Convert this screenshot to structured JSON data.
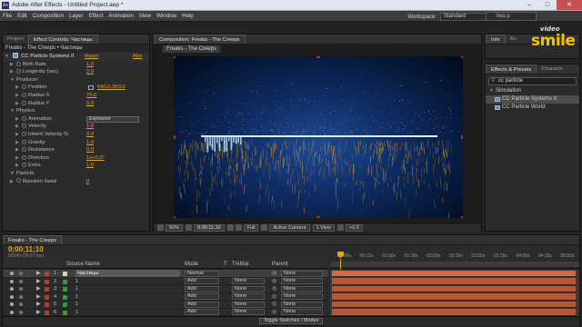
{
  "window": {
    "app_icon": "Ae",
    "title": "Adobe After Effects - Untitled Project.aep *"
  },
  "menu": [
    "File",
    "Edit",
    "Composition",
    "Layer",
    "Effect",
    "Animation",
    "View",
    "Window",
    "Help"
  ],
  "workspace": {
    "label": "Workspace:",
    "value": "Standard"
  },
  "help_search": {
    "placeholder": "Sea       p"
  },
  "left_panel": {
    "tabs": [
      "Project",
      "Effect Controls: Частицы"
    ],
    "header": "Freaks - The Creeps • Частицы",
    "effect": {
      "name": "CC Particle Systems II",
      "reset": "Reset",
      "about": "Abo"
    },
    "rows": [
      {
        "label": "Birth Rate",
        "value": "1.0",
        "indent": 1
      },
      {
        "label": "Longevity (sec)",
        "value": "2.0",
        "indent": 1
      },
      {
        "label": "Producer",
        "value": "",
        "indent": 1,
        "group": true
      },
      {
        "label": "Position",
        "value": "640.0,360.0",
        "indent": 2
      },
      {
        "label": "Radius X",
        "value": "75.0",
        "indent": 2
      },
      {
        "label": "Radius Y",
        "value": "0.0",
        "indent": 2
      },
      {
        "label": "Physics",
        "value": "",
        "indent": 1,
        "group": true
      },
      {
        "label": "Animation",
        "value": "Explosive",
        "indent": 2,
        "dropdown": true
      },
      {
        "label": "Velocity",
        "value": "1.0",
        "indent": 2
      },
      {
        "label": "Inherit Velocity %",
        "value": "0.0",
        "indent": 2
      },
      {
        "label": "Gravity",
        "value": "1.0",
        "indent": 2
      },
      {
        "label": "Resistance",
        "value": "0.0",
        "indent": 2
      },
      {
        "label": "Direction",
        "value": "1x+0.0°",
        "indent": 2
      },
      {
        "label": "Extra",
        "value": "1.0",
        "indent": 2
      },
      {
        "label": "Particle",
        "value": "",
        "indent": 1,
        "group": true
      },
      {
        "label": "Random Seed",
        "value": "0",
        "indent": 1
      }
    ]
  },
  "composition": {
    "tab": "Composition: Freaks - The Creeps",
    "sub_tab": "Freaks - The Creeps",
    "zoom": "50%",
    "timecode": "0;00;11;10",
    "resolution": "Full",
    "camera": "Active Camera",
    "views": "1 View",
    "exposure": "+0.0"
  },
  "right_panel": {
    "top_tabs": [
      "Info",
      "Au"
    ],
    "fx_tabs": [
      "Effects & Presets",
      "Characte"
    ],
    "search_value": "cc particle",
    "category": "Simulation",
    "items": [
      "CC Particle Systems II",
      "CC Particle World"
    ],
    "logo_small": "video",
    "logo_big": "smile"
  },
  "timeline": {
    "tab": "Freaks - The Creeps",
    "timecode": "0;00;11;10",
    "fps": "00340 (29.97 fps)",
    "columns": {
      "source": "Source Name",
      "mode": "Mode",
      "t": "T",
      "trkmat": "TrkMat",
      "parent": "Parent"
    },
    "ruler": [
      "00:00s",
      "00:15s",
      "01:00s",
      "01:15s",
      "02:00s",
      "02:15s",
      "03:00s",
      "03:15s",
      "04:00s",
      "04:15s",
      "05:00s"
    ],
    "layers": [
      {
        "num": "1",
        "name": "Частицы",
        "mode": "Normal",
        "trkmat": "",
        "parent": "None",
        "color": "#c0392b",
        "solid_color": "#d0d0d0"
      },
      {
        "num": "2",
        "name": "1",
        "mode": "Add",
        "trkmat": "None",
        "parent": "None",
        "color": "#c0392b",
        "solid_color": "#2e9e2e"
      },
      {
        "num": "3",
        "name": "1",
        "mode": "Add",
        "trkmat": "None",
        "parent": "None",
        "color": "#c0392b",
        "solid_color": "#2e9e2e"
      },
      {
        "num": "4",
        "name": "1",
        "mode": "Add",
        "trkmat": "None",
        "parent": "None",
        "color": "#c0392b",
        "solid_color": "#2e9e2e"
      },
      {
        "num": "5",
        "name": "1",
        "mode": "Add",
        "trkmat": "None",
        "parent": "None",
        "color": "#c0392b",
        "solid_color": "#2e9e2e"
      },
      {
        "num": "6",
        "name": "1",
        "mode": "Add",
        "trkmat": "None",
        "parent": "None",
        "color": "#c0392b",
        "solid_color": "#2e9e2e"
      }
    ],
    "toggle_label": "Toggle Switches / Modes"
  },
  "colors": {
    "accent_orange": "#e5a41d",
    "bar": "#b9573b",
    "timecode": "#e5a41d"
  }
}
